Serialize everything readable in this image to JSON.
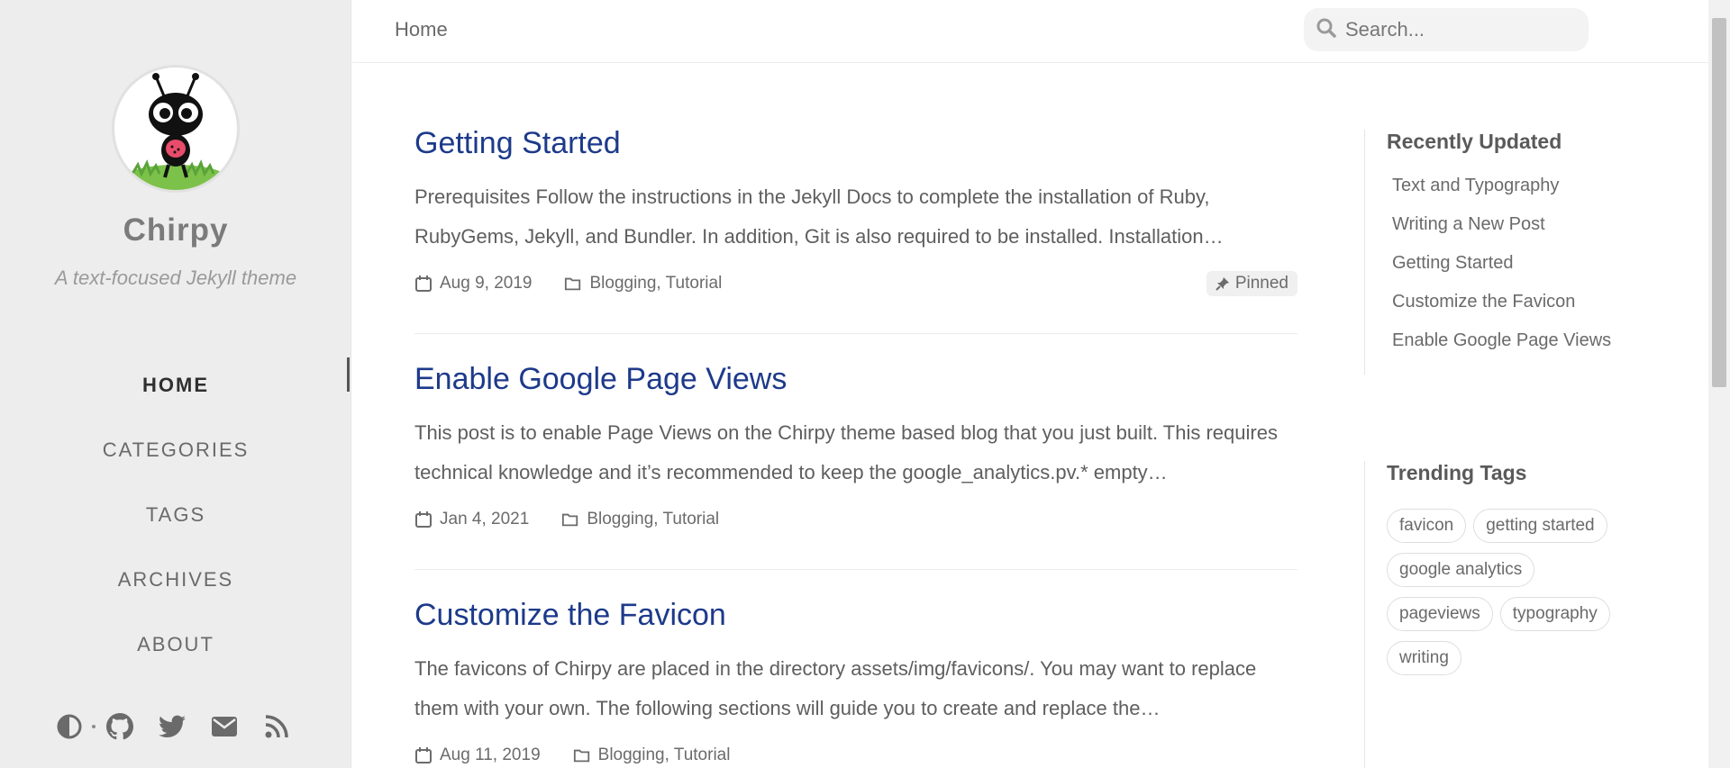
{
  "sidebar": {
    "title": "Chirpy",
    "subtitle": "A text-focused Jekyll theme",
    "nav": [
      {
        "label": "HOME"
      },
      {
        "label": "CATEGORIES"
      },
      {
        "label": "TAGS"
      },
      {
        "label": "ARCHIVES"
      },
      {
        "label": "ABOUT"
      }
    ],
    "icons": [
      "theme-toggle-icon",
      "github-icon",
      "twitter-icon",
      "email-icon",
      "rss-icon"
    ]
  },
  "topbar": {
    "breadcrumb": "Home",
    "search_placeholder": "Search..."
  },
  "posts": [
    {
      "title": "Getting Started",
      "excerpt": "Prerequisites Follow the instructions in the Jekyll Docs to complete the installation of Ruby, RubyGems, Jekyll, and Bundler. In addition, Git is also required to be installed. Installation…",
      "date": "Aug 9, 2019",
      "categories": "Blogging, Tutorial",
      "badge": "Pinned"
    },
    {
      "title": "Enable Google Page Views",
      "excerpt": "This post is to enable Page Views on the Chirpy theme based blog that you just built. This requires technical knowledge and it’s recommended to keep the google_analytics.pv.* empty…",
      "date": "Jan 4, 2021",
      "categories": "Blogging, Tutorial"
    },
    {
      "title": "Customize the Favicon",
      "excerpt": "The favicons of Chirpy are placed in the directory assets/img/favicons/. You may want to replace them with your own. The following sections will guide you to create and replace the…",
      "date": "Aug 11, 2019",
      "categories": "Blogging, Tutorial"
    }
  ],
  "panel": {
    "recently_updated_title": "Recently Updated",
    "recently_updated": [
      "Text and Typography",
      "Writing a New Post",
      "Getting Started",
      "Customize the Favicon",
      "Enable Google Page Views"
    ],
    "trending_tags_title": "Trending Tags",
    "tags": [
      "favicon",
      "getting started",
      "google analytics",
      "pageviews",
      "typography",
      "writing"
    ]
  },
  "colors": {
    "sidebar_bg": "#ededed",
    "post_title": "#1d3a8a",
    "text": "#5e5e5e"
  }
}
